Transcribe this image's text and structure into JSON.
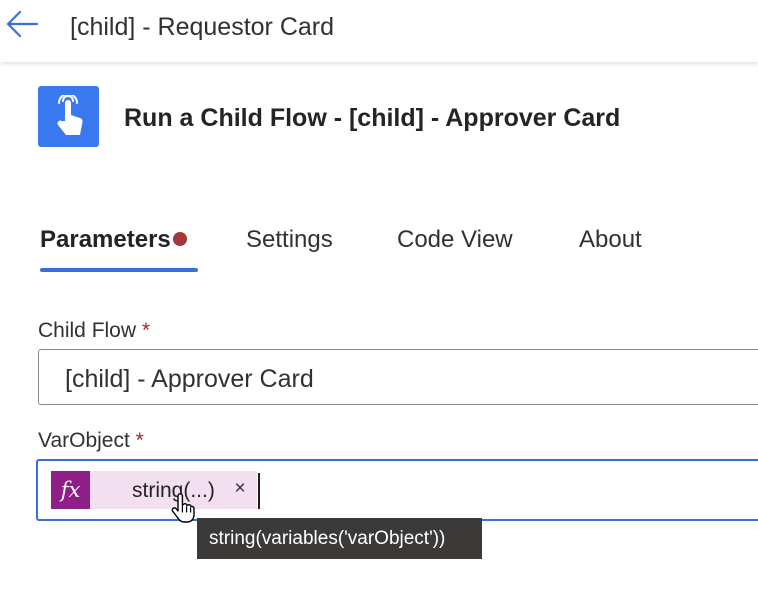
{
  "header": {
    "title": "[child] - Requestor Card",
    "back_icon": "arrow-left-icon"
  },
  "action": {
    "title": "Run a Child Flow - [child] - Approver Card",
    "icon": "touch-hand-icon",
    "icon_color": "#3a78f0"
  },
  "tabs": [
    {
      "label": "Parameters",
      "active": true,
      "has_error": true
    },
    {
      "label": "Settings",
      "active": false
    },
    {
      "label": "Code View",
      "active": false
    },
    {
      "label": "About",
      "active": false
    }
  ],
  "fields": {
    "child_flow": {
      "label": "Child Flow",
      "required_marker": "*",
      "value": "[child] - Approver Card"
    },
    "var_object": {
      "label": "VarObject",
      "required_marker": "*",
      "token": {
        "fx_label": "fx",
        "text": "string(...)",
        "remove_label": "×"
      }
    }
  },
  "tooltip": {
    "text": "string(variables('varObject'))"
  },
  "colors": {
    "accent": "#3a6fd8",
    "error_dot": "#a4373a",
    "required": "#a4262c",
    "fx_badge": "#8f1e87",
    "token_bg": "#f2dff0",
    "tooltip_bg": "#3b3a39"
  }
}
